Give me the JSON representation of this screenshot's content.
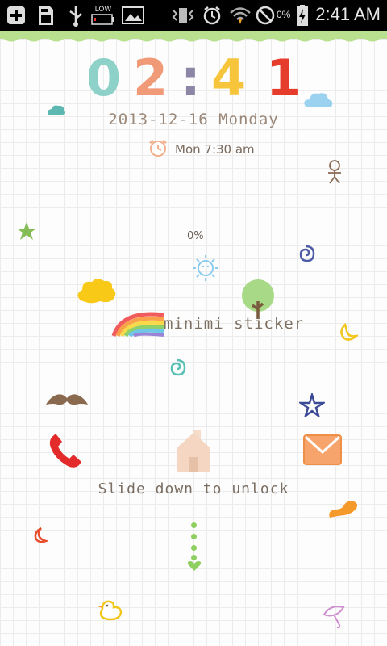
{
  "status_bar": {
    "icons": [
      "add-icon",
      "sd-card-icon",
      "usb-icon",
      "battery-low-icon",
      "gallery-icon",
      "vibrate-icon",
      "alarm-icon",
      "wifi-icon",
      "blocked-icon",
      "charging-icon"
    ],
    "battery_label": "LOW",
    "battery_percent": "0%",
    "time": "2:41 AM"
  },
  "lockscreen": {
    "clock_digits": [
      "0",
      "2",
      ":",
      "4",
      "1"
    ],
    "digit_colors": [
      "#8dd1c8",
      "#f19a78",
      "#8e86a6",
      "#f7c53c",
      "#e63c2c"
    ],
    "date": "2013-12-16  Monday",
    "alarm_time": "Mon 7:30 am",
    "battery_level": "0%",
    "brand": "minimi sticker",
    "unlock_hint": "Slide down to unlock"
  },
  "shortcuts": {
    "phone": "phone-icon",
    "home": "home-icon",
    "message": "envelope-icon"
  }
}
